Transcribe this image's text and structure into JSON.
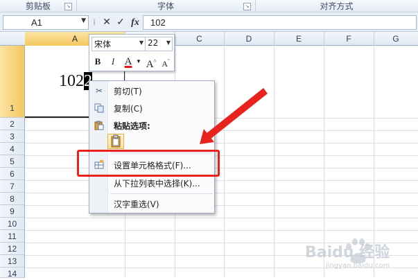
{
  "ribbon": {
    "groups": [
      "剪贴板",
      "字体",
      "对齐方式"
    ]
  },
  "formula_bar": {
    "name_box": "A1",
    "formula": "102",
    "cancel_symbol": "✕",
    "enter_symbol": "✓",
    "fx_label": "fx"
  },
  "sheet": {
    "columns": [
      "A",
      "B",
      "C",
      "D",
      "E",
      "F",
      "G"
    ],
    "rows": [
      "1",
      "2",
      "3",
      "4",
      "5",
      "6",
      "7",
      "8",
      "9",
      "10",
      "11",
      "12",
      "13",
      "14"
    ],
    "selected_column": "A",
    "selected_row": "1",
    "cell_a1": {
      "before": "102",
      "selected": "2"
    }
  },
  "mini_toolbar": {
    "font_name": "宋体",
    "font_size": "22",
    "bold": "B",
    "italic": "I",
    "font_color": "A",
    "grow_font": "A",
    "shrink_font": "A",
    "font_color_hex": "#e01b1b"
  },
  "context_menu": {
    "items": [
      {
        "label": "剪切(T)",
        "icon": "scissors-icon"
      },
      {
        "label": "复制(C)",
        "icon": "copy-icon"
      },
      {
        "label": "粘贴选项:",
        "icon": "paste-icon"
      },
      {
        "label": "设置单元格格式(F)...",
        "icon": "format-cells-icon"
      },
      {
        "label": "从下拉列表中选择(K)...",
        "icon": ""
      },
      {
        "label": "汉字重选(V)",
        "icon": ""
      }
    ]
  },
  "annotation": {
    "color": "#e8231d"
  },
  "watermark": {
    "text": "Baidu 经验",
    "subtext": "jingyan.baidu.com"
  }
}
